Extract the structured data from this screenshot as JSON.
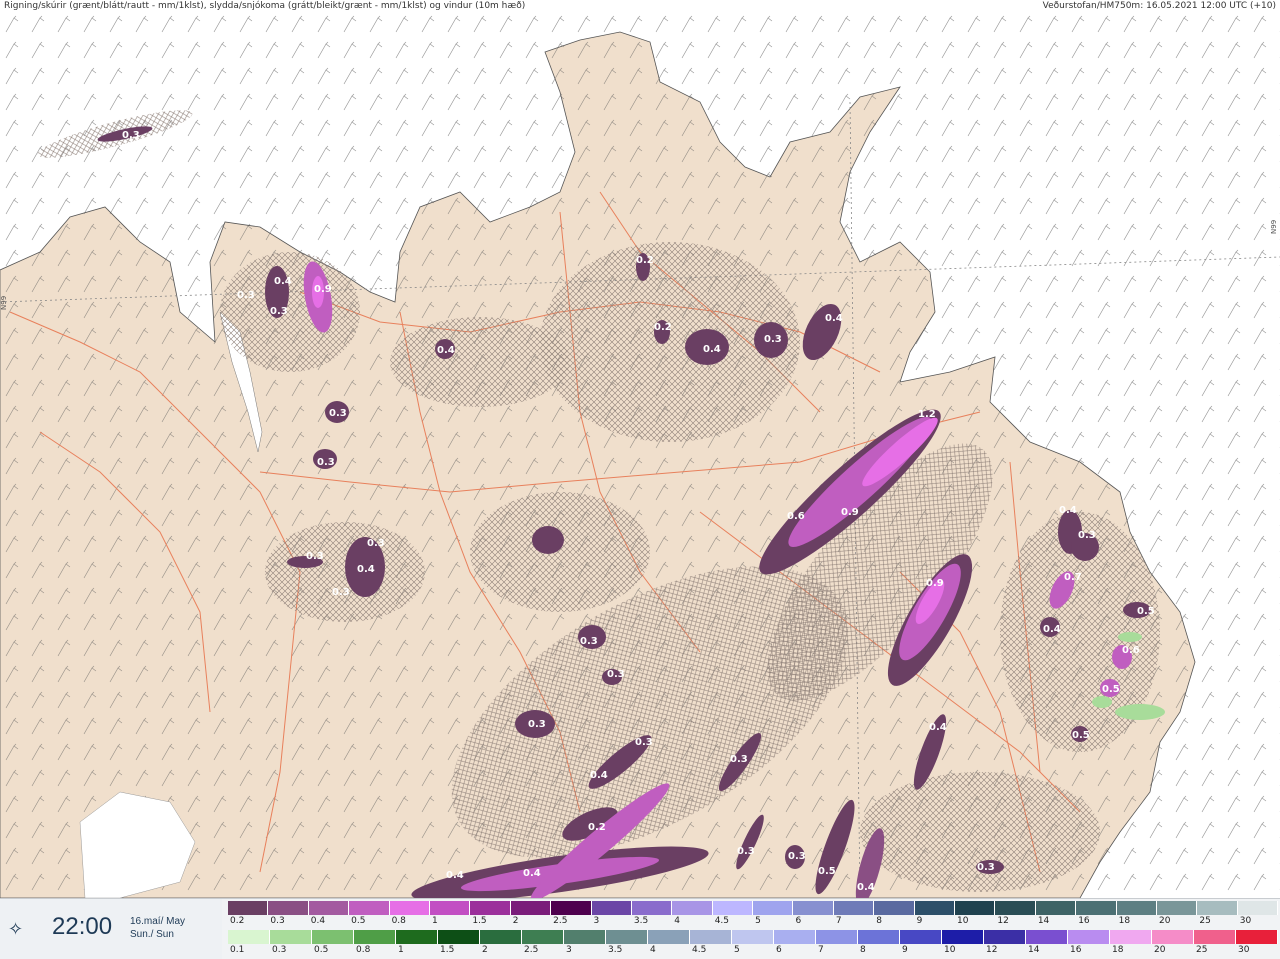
{
  "header": {
    "left_text": "Rigning/skúrir (grænt/blátt/rautt - mm/1klst), slydda/snjókoma (grátt/bleikt/grænt - mm/1klst) og vindur (10m hæð)",
    "right_text": "Veðurstofan/HM750m: 16.05.2021 12:00 UTC (+10)"
  },
  "map": {
    "latitude_label": "N99",
    "land_color": "#f0dfcc",
    "sea_color": "#ffffff",
    "road_color": "#e8805c",
    "precip_labels": [
      {
        "text": "0.3"
      },
      {
        "text": "0.4"
      },
      {
        "text": "0.9"
      },
      {
        "text": "0.3"
      },
      {
        "text": "0.3"
      },
      {
        "text": "0.4"
      },
      {
        "text": "0.3"
      },
      {
        "text": "0.3"
      },
      {
        "text": "0.3"
      },
      {
        "text": "0.4"
      },
      {
        "text": "0.3"
      },
      {
        "text": "0.3"
      },
      {
        "text": "0.2"
      },
      {
        "text": "0.2"
      },
      {
        "text": "0.4"
      },
      {
        "text": "0.3"
      },
      {
        "text": "0.4"
      },
      {
        "text": "1.2"
      },
      {
        "text": "0.6"
      },
      {
        "text": "0.9"
      },
      {
        "text": "0.9"
      },
      {
        "text": "0.4"
      },
      {
        "text": "0.3"
      },
      {
        "text": "0.7"
      },
      {
        "text": "0.4"
      },
      {
        "text": "0.5"
      },
      {
        "text": "0.6"
      },
      {
        "text": "0.5"
      },
      {
        "text": "0.5"
      },
      {
        "text": "0.3"
      },
      {
        "text": "0.3"
      },
      {
        "text": "0.3"
      },
      {
        "text": "0.4"
      },
      {
        "text": "0.3"
      },
      {
        "text": "0.3"
      },
      {
        "text": "0.4"
      },
      {
        "text": "0.2"
      },
      {
        "text": "0.3"
      },
      {
        "text": "0.3"
      },
      {
        "text": "0.5"
      },
      {
        "text": "0.4"
      },
      {
        "text": "0.4"
      },
      {
        "text": "0.4"
      },
      {
        "text": "0.3"
      }
    ]
  },
  "footer": {
    "icon": "wind-compass-icon",
    "time": "22:00",
    "date_line1": "16.maí/ May",
    "date_line2": "Sun./ Sun",
    "snow_scale": {
      "labels": [
        "0.2",
        "0.3",
        "0.4",
        "0.5",
        "0.8",
        "1",
        "1.5",
        "2",
        "2.5",
        "3",
        "3.5",
        "4",
        "4.5",
        "5",
        "6",
        "7",
        "8",
        "9",
        "10",
        "12",
        "14",
        "16",
        "18",
        "20",
        "25",
        "30"
      ],
      "colors": [
        "#6a3f63",
        "#8a4f84",
        "#a35aa0",
        "#c05ec0",
        "#e66fe6",
        "#c24ec3",
        "#9b2f9b",
        "#7a1c7a",
        "#4e004e",
        "#6b46a6",
        "#8a6ccc",
        "#a895e6",
        "#bdb7ff",
        "#9fa4ee",
        "#8790d0",
        "#6f7bb8",
        "#5a6aa0",
        "#2d4f69",
        "#20424f",
        "#2a4d55",
        "#3e6366",
        "#4c7074",
        "#5e7f83",
        "#7a9699",
        "#a7bcbf",
        "#dfe6e7"
      ]
    },
    "rain_scale": {
      "labels": [
        "0.1",
        "0.3",
        "0.5",
        "0.8",
        "1",
        "1.5",
        "2",
        "2.5",
        "3",
        "3.5",
        "4",
        "4.5",
        "5",
        "6",
        "7",
        "8",
        "9",
        "10",
        "12",
        "14",
        "16",
        "18",
        "20",
        "25",
        "30"
      ],
      "colors": [
        "#d9f5d0",
        "#a8dc9a",
        "#7cc070",
        "#4f9e47",
        "#1e6b1e",
        "#0d4f16",
        "#2a6d3e",
        "#3e7e52",
        "#527f6d",
        "#6e8f92",
        "#8aa1b8",
        "#a7b4d6",
        "#bfc6ef",
        "#a9aff0",
        "#8d93e6",
        "#6c73d8",
        "#4848c4",
        "#1d1da8",
        "#3b2fa6",
        "#7a4fd0",
        "#b98cf0",
        "#f0a8f0",
        "#f58cc8",
        "#f0608c",
        "#e8203a"
      ]
    }
  }
}
